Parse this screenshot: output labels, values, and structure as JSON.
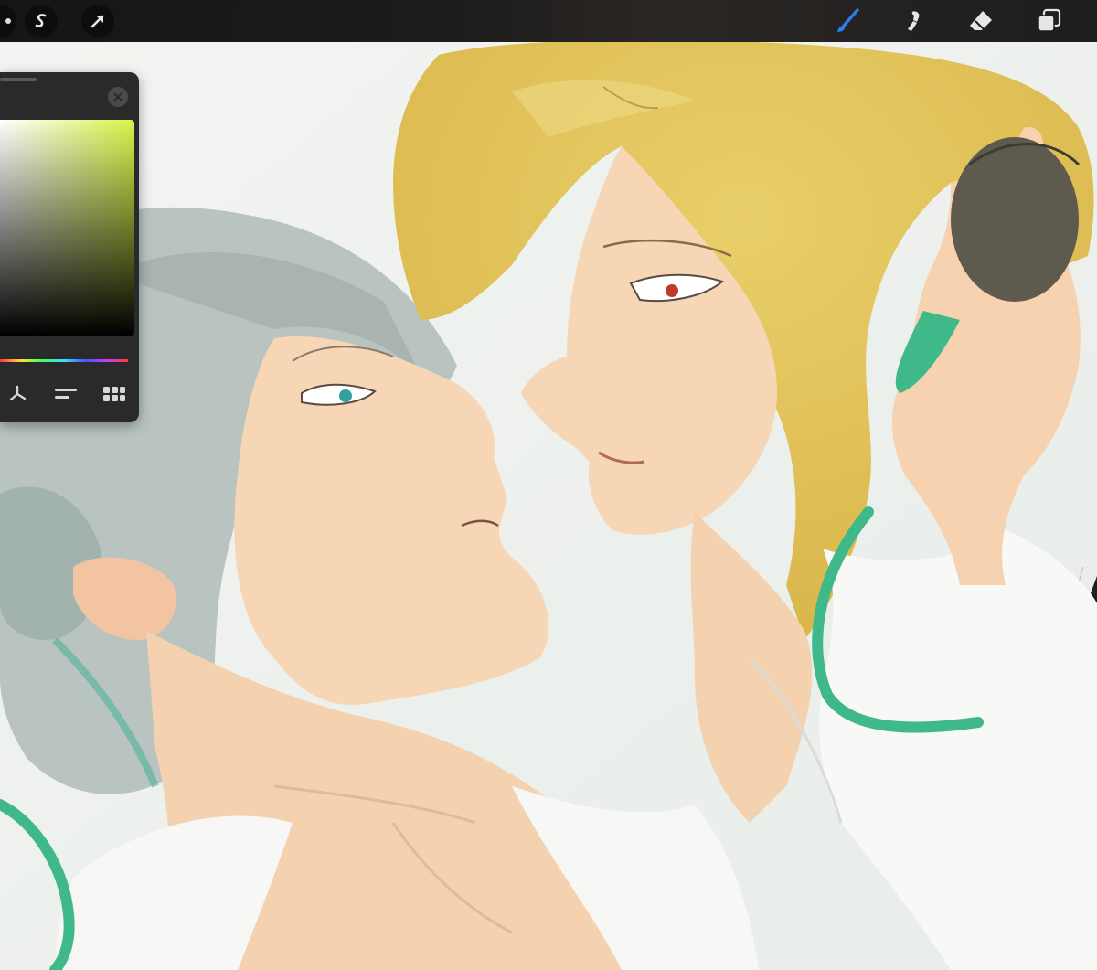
{
  "toolbar": {
    "left": [
      {
        "name": "adjustments-icon"
      },
      {
        "name": "selection-icon"
      },
      {
        "name": "transform-icon"
      }
    ],
    "right": [
      {
        "name": "brush-icon",
        "active": true,
        "color": "#2e7df0"
      },
      {
        "name": "smudge-icon",
        "active": false
      },
      {
        "name": "eraser-icon",
        "active": false
      },
      {
        "name": "layers-icon",
        "active": false
      }
    ]
  },
  "color_panel": {
    "hue_color": "#d8f54a",
    "modes": [
      "harmony-icon",
      "value-icon",
      "palettes-icon"
    ]
  },
  "colors": {
    "bg_canvas": "#eef2ee",
    "hair_blond": "#e3c25a",
    "hair_silver": "#b6c0bc",
    "skin": "#f6d7b6",
    "stroke_green": "#3fb98a",
    "eye_teal": "#2fa39a",
    "eye_red": "#c0392b"
  }
}
